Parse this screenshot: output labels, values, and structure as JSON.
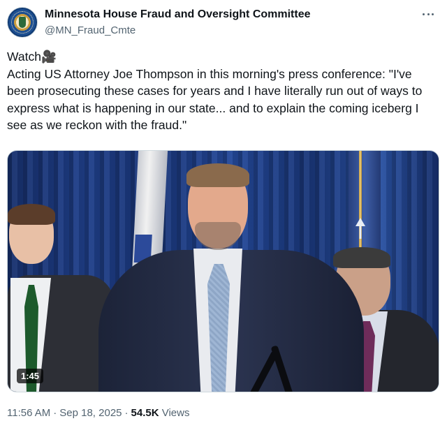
{
  "header": {
    "display_name": "Minnesota House Fraud and Oversight Committee",
    "handle": "@MN_Fraud_Cmte",
    "avatar_icon": "committee-seal-icon",
    "more_icon": "more-horizontal-icon"
  },
  "tweet": {
    "text": "Watch🎥\nActing US Attorney Joe Thompson in this morning's press conference: \"I've been prosecuting these cases for years and I have literally run out of ways to express what is happening in our state... and to explain the coming iceberg I see as we reckon with the fraud.\""
  },
  "media": {
    "type": "video",
    "duration": "1:45"
  },
  "meta": {
    "time": "11:56 AM",
    "separator": "·",
    "date": "Sep 18, 2025",
    "views_count": "54.5K",
    "views_label": "Views"
  },
  "colors": {
    "text_primary": "#0f1419",
    "text_secondary": "#536471",
    "border": "#cfd9de",
    "background": "#ffffff"
  }
}
